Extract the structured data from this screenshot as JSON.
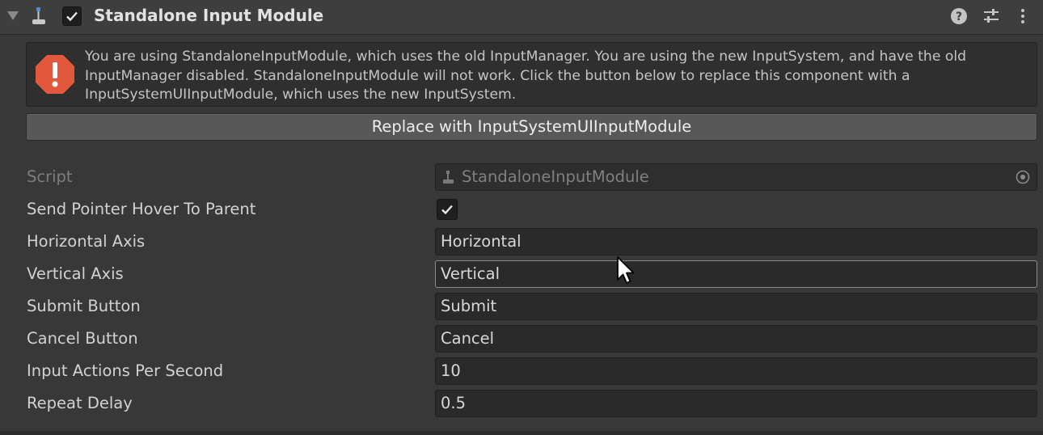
{
  "component": {
    "title": "Standalone Input Module",
    "enabled": true,
    "icons": [
      "foldout-arrow-icon",
      "input-module-icon",
      "help-icon",
      "presets-icon",
      "kebab-menu-icon"
    ]
  },
  "warning": {
    "text": "You are using StandaloneInputModule, which uses the old InputManager. You are using the new InputSystem, and have the old InputManager disabled. StandaloneInputModule will not work. Click the button below to replace this component with a InputSystemUIInputModule, which uses the new InputSystem.",
    "icon": "error-icon",
    "color": "#e2583c"
  },
  "replace_button": {
    "label": "Replace with InputSystemUIInputModule"
  },
  "properties": {
    "script": {
      "label": "Script",
      "value": "StandaloneInputModule"
    },
    "send_pointer_hover": {
      "label": "Send Pointer Hover To Parent",
      "checked": true
    },
    "horizontal_axis": {
      "label": "Horizontal Axis",
      "value": "Horizontal"
    },
    "vertical_axis": {
      "label": "Vertical Axis",
      "value": "Vertical"
    },
    "submit_button": {
      "label": "Submit Button",
      "value": "Submit"
    },
    "cancel_button": {
      "label": "Cancel Button",
      "value": "Cancel"
    },
    "input_actions_per_second": {
      "label": "Input Actions Per Second",
      "value": "10"
    },
    "repeat_delay": {
      "label": "Repeat Delay",
      "value": "0.5"
    }
  }
}
